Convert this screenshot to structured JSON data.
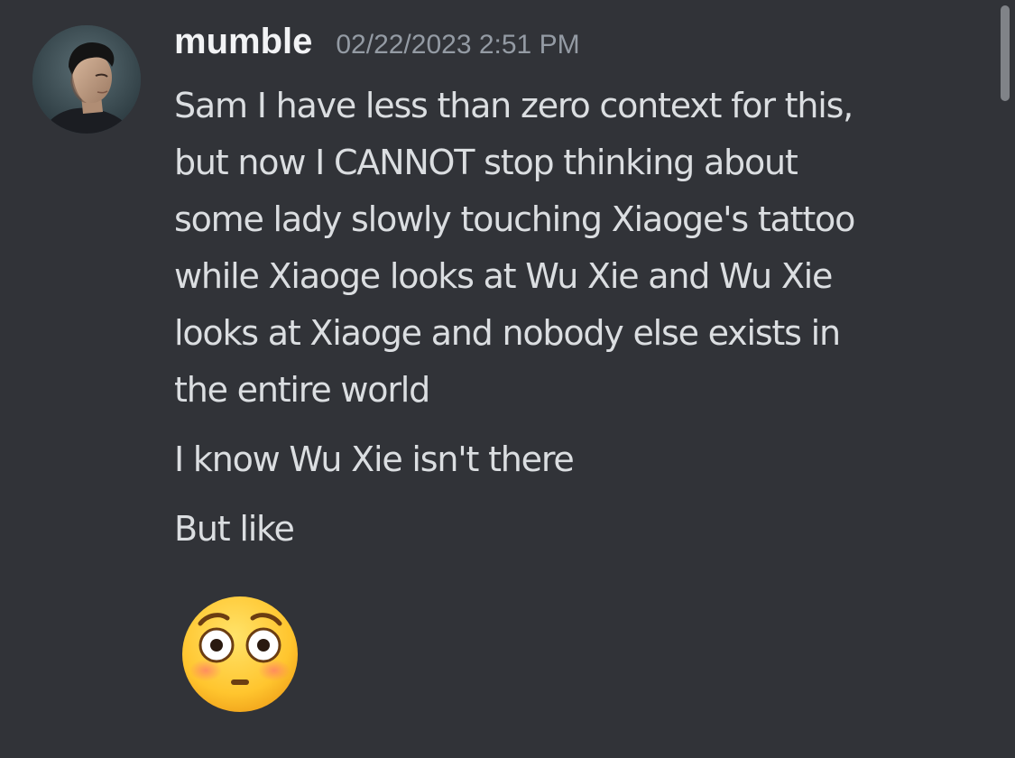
{
  "message": {
    "username": "mumble",
    "timestamp": "02/22/2023 2:51 PM",
    "lines": [
      "Sam I have less than zero context for this,",
      "but now I CANNOT stop thinking about",
      "some lady slowly touching Xiaoge's tattoo",
      "while Xiaoge looks at Wu Xie and Wu Xie",
      "looks at Xiaoge and nobody else exists in",
      "the entire world"
    ],
    "followups": [
      "I know Wu Xie isn't there",
      "But like"
    ],
    "emoji": "flushed-face-emoji"
  },
  "colors": {
    "background": "#313338",
    "username": "#f2f3f5",
    "timestamp": "#949ba4",
    "text": "#dbdee1"
  }
}
